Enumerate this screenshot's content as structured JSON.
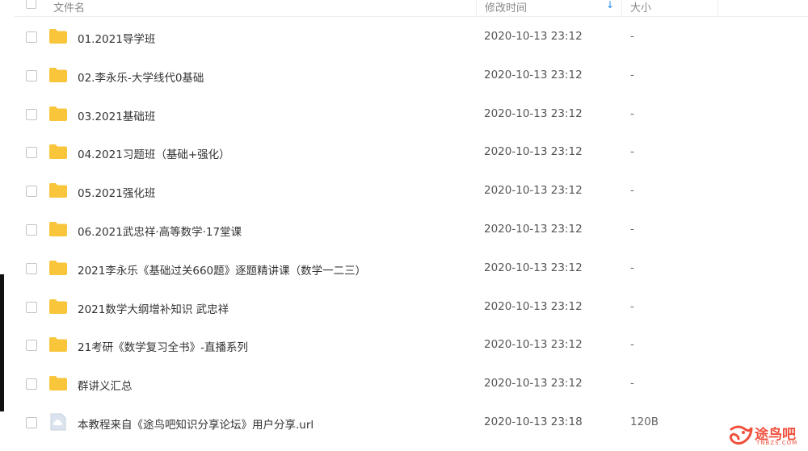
{
  "header": {
    "name_label": "文件名",
    "time_label": "修改时间",
    "sort_icon": "arrow-down-icon",
    "size_label": "大小"
  },
  "rows": [
    {
      "name": "01.2021导学班",
      "time": "2020-10-13 23:12",
      "size": "-",
      "icon": "folder-icon"
    },
    {
      "name": "02.李永乐-大学线代0基础",
      "time": "2020-10-13 23:12",
      "size": "-",
      "icon": "folder-icon"
    },
    {
      "name": "03.2021基础班",
      "time": "2020-10-13 23:12",
      "size": "-",
      "icon": "folder-icon"
    },
    {
      "name": "04.2021习题班（基础+强化）",
      "time": "2020-10-13 23:12",
      "size": "-",
      "icon": "folder-icon"
    },
    {
      "name": "05.2021强化班",
      "time": "2020-10-13 23:12",
      "size": "-",
      "icon": "folder-icon"
    },
    {
      "name": "06.2021武忠祥·高等数学·17堂课",
      "time": "2020-10-13 23:12",
      "size": "-",
      "icon": "folder-icon"
    },
    {
      "name": "2021李永乐《基础过关660题》逐题精讲课（数学一二三）",
      "time": "2020-10-13 23:12",
      "size": "-",
      "icon": "folder-icon"
    },
    {
      "name": "2021数学大纲增补知识 武忠祥",
      "time": "2020-10-13 23:12",
      "size": "-",
      "icon": "folder-icon"
    },
    {
      "name": "21考研《数学复习全书》-直播系列",
      "time": "2020-10-13 23:12",
      "size": "-",
      "icon": "folder-icon"
    },
    {
      "name": "群讲义汇总",
      "time": "2020-10-13 23:12",
      "size": "-",
      "icon": "folder-icon"
    },
    {
      "name": "本教程来自《途鸟吧知识分享论坛》用户分享.url",
      "time": "2020-10-13 23:18",
      "size": "120B",
      "icon": "cloud-file-icon"
    }
  ],
  "watermark": {
    "text": "途鸟吧",
    "sub": "TNBZS.COM"
  },
  "colors": {
    "folder": "#f8c53b",
    "accent": "#2a8bf2",
    "watermark": "#f0503c"
  }
}
